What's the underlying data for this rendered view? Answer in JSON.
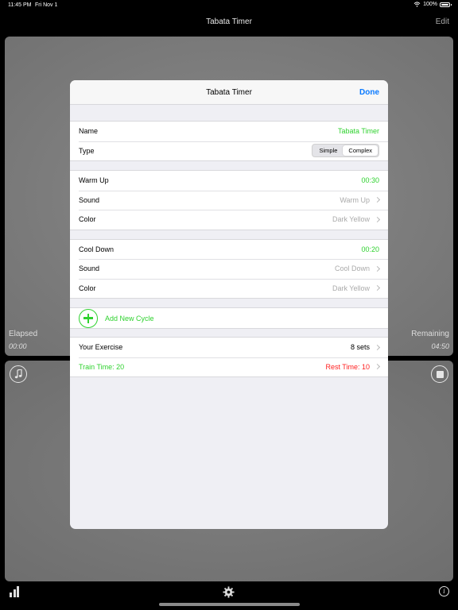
{
  "status_bar": {
    "time": "11:45 PM",
    "date": "Fri Nov 1",
    "battery": "100%"
  },
  "nav": {
    "title": "Tabata Timer",
    "edit_label": "Edit"
  },
  "timer": {
    "elapsed_label": "Elapsed",
    "elapsed_value": "00:00",
    "remaining_label": "Remaining",
    "remaining_value": "04:50"
  },
  "modal": {
    "title": "Tabata Timer",
    "done_label": "Done",
    "name_label": "Name",
    "name_value": "Tabata Timer",
    "type_label": "Type",
    "type_options": [
      "Simple",
      "Complex"
    ],
    "type_selected": "Complex",
    "warm_up": {
      "label": "Warm Up",
      "duration": "00:30",
      "sound_label": "Sound",
      "sound_value": "Warm Up",
      "color_label": "Color",
      "color_value": "Dark Yellow"
    },
    "cool_down": {
      "label": "Cool Down",
      "duration": "00:20",
      "sound_label": "Sound",
      "sound_value": "Cool Down",
      "color_label": "Color",
      "color_value": "Dark Yellow"
    },
    "add_cycle_label": "Add New Cycle",
    "exercise": {
      "label": "Your Exercise",
      "sets": "8 sets",
      "train": "Train Time: 20",
      "rest": "Rest Time: 10"
    }
  },
  "colors": {
    "accent_green": "#2fd22f",
    "accent_blue": "#0a7aff",
    "rest_red": "#ff2020"
  },
  "icons": [
    "wifi-icon",
    "battery-icon",
    "music-note-icon",
    "stop-icon",
    "bar-chart-icon",
    "gear-icon",
    "info-icon",
    "plus-circle-icon",
    "chevron-right-icon"
  ]
}
